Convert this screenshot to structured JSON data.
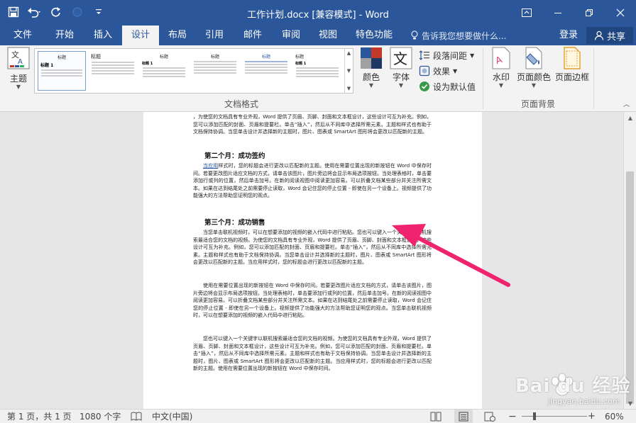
{
  "window": {
    "title": "工作计划.docx [兼容模式] - Word"
  },
  "tabs": [
    {
      "label": "文件"
    },
    {
      "label": "开始"
    },
    {
      "label": "插入"
    },
    {
      "label": "设计"
    },
    {
      "label": "布局"
    },
    {
      "label": "引用"
    },
    {
      "label": "邮件"
    },
    {
      "label": "审阅"
    },
    {
      "label": "视图"
    },
    {
      "label": "特色功能"
    }
  ],
  "active_tab": "设计",
  "tellme": {
    "placeholder": "告诉我您想要做什么..."
  },
  "account": {
    "signin": "登录",
    "share": "共享"
  },
  "ribbon": {
    "theme_label": "主题",
    "style_thumbs": [
      {
        "title": "标题",
        "heading": "标题 1"
      },
      {
        "title": "标题",
        "heading": ""
      },
      {
        "title": "标题",
        "heading": "标题 1"
      },
      {
        "title": "标题",
        "heading": ""
      },
      {
        "title": "标题",
        "heading": ""
      },
      {
        "title": "标题",
        "heading": "标题 1"
      }
    ],
    "colors_label": "颜色",
    "fonts_label": "字体",
    "para_spacing_label": "段落间距",
    "effects_label": "效果",
    "set_default_label": "设为默认值",
    "doc_format_group": "文档格式",
    "watermark_label": "水印",
    "page_color_label": "页面颜色",
    "page_border_label": "页面边框",
    "page_bg_group": "页面背景"
  },
  "document": {
    "p0": "，为使您的文档具有专业外观，Word 提供了页眉、页脚、封面和文本框设计，这些设计可互为补充。例如，您可以添加匹配的封面、页眉和提要栏。单击“插入”，然后从不同库中选择所需元素。主题和样式也有助于文档保持协调。当您单击设计并选择新的主题时，图片、图表或 SmartArt 图形将会更改以匹配新的主题。",
    "h2": "第二个月：成功签约",
    "p1_link": "当应用",
    "p1": "样式时，您的标题会进行更改以匹配新的主题。使用在需要位置出现的新按钮在 Word 中保存时间。若要更改图片适应文档的方式，请单击该图片，图片旁边将会显示布局选项按钮。当处理表格时，单击要添加行或列的位置，然后单击加号。在新的阅读视图中阅读更加容易。可以折叠文档某些部分并关注所需文本。如果在达到结尾处之前需要停止读取，Word 会记住您的停止位置 - 即使在另一个设备上。视频提供了功能强大的方法帮助您证明您的观点。",
    "h3": "第三个月：成功销售",
    "p2": "当您单击联机视频时，可以在想要添加的视频的嵌入代码中进行粘贴。您也可以键入一个关键字以联机搜索最适合您的文档的视频。为使您的文档具有专业外观，Word 提供了页眉、页脚、封面和文本框设计，这些设计可互为补充。例如，您可以添加匹配的封面、页眉和提要栏。单击“插入”，然后从不同库中选择所需元素。主题和样式也有助于文档保持协调。当您单击设计并选择新的主题时，图片、图表或 SmartArt 图形将会更改以匹配新的主题。当应用样式时，您的标题会进行更改以匹配新的主题。",
    "p3": "使用在需要位置出现的新按钮在 Word 中保存时间。若要更改图片适应文档的方式，请单击该图片，图片旁边将会显示布局选项按钮。当处理表格时，单击要添加行或列的位置，然后单击加号。在新的阅读视图中阅读更加容易。可以折叠文档某些部分并关注所需文本。如果在达到结尾处之前需要停止读取，Word 会记住您的停止位置 - 即使在另一个设备上。视频提供了功能强大的方法帮助您证明您的观点。当您单击联机视频时，可以在想要添加的视频的嵌入代码中进行粘贴。",
    "p4": "您也可以键入一个关键字以联机搜索最适合您的文档的视频。为使您的文档具有专业外观，Word 提供了页眉、页脚、封面和文本框设计，这些设计可互为补充。例如，您可以添加匹配的封面、页眉和提要栏。单击“插入”，然后从不同库中选择所需元素。主题和样式也有助于文档保持协调。当您单击设计并选择新的主题时，图片、图表或 SmartArt 图形将会更改以匹配新的主题。当应用样式时，您的标题会进行更改以匹配新的主题。使用在需要位置出现的新按钮在 Word 中保存时间。"
  },
  "status": {
    "page": "第 1 页，共 1 页",
    "words": "1080 个字",
    "language": "中文(中国)",
    "zoom": "60%"
  },
  "watermark_text": {
    "brand": "Bai du 经验",
    "url": "jingyan.baidu.com"
  },
  "colors": {
    "accent": "#2b579a",
    "annotation_arrow": "#f0246e"
  }
}
